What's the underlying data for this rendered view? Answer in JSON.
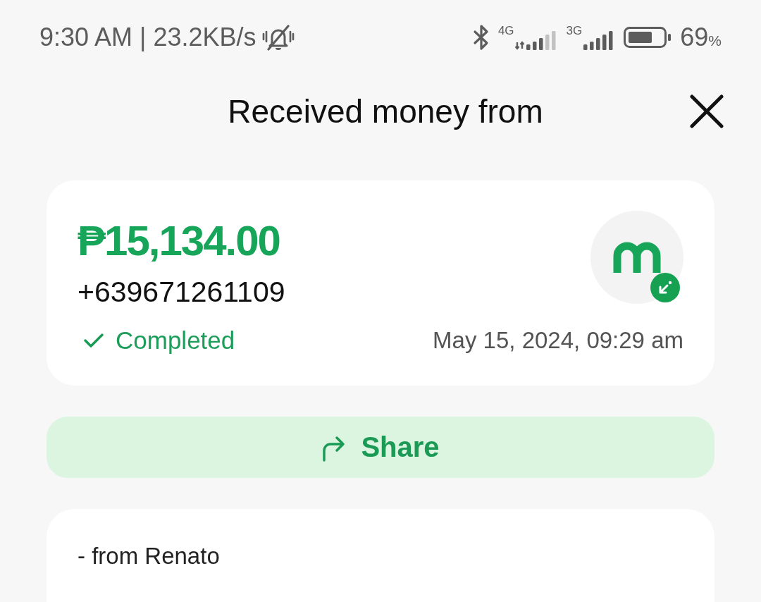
{
  "status_bar": {
    "time_and_speed": "9:30 AM | 23.2KB/s",
    "networks": [
      {
        "label": "4G",
        "data_active": true
      },
      {
        "label": "3G",
        "data_active": false
      }
    ],
    "battery_percent": "69",
    "percent_sign": "%"
  },
  "header": {
    "title": "Received money from"
  },
  "transaction": {
    "amount": "₱15,134.00",
    "phone": "+639671261109",
    "status": "Completed",
    "date": "May 15, 2024, 09:29 am"
  },
  "share_button": {
    "label": "Share"
  },
  "note": {
    "text": "- from Renato"
  }
}
